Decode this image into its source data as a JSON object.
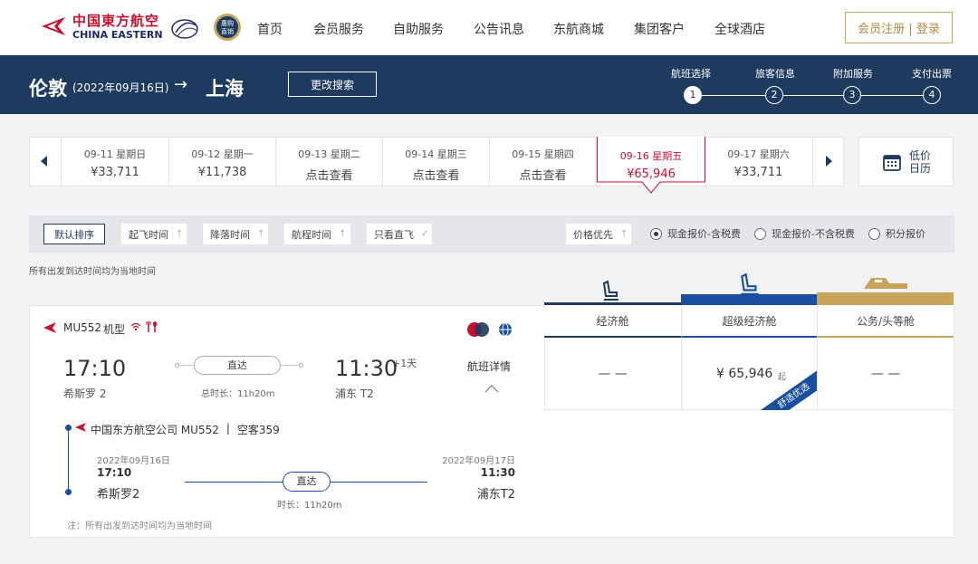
{
  "brand": {
    "name_cn": "中国東方航空",
    "name_en": "CHINA EASTERN",
    "skyteam": "SKYTEAM",
    "badge": "惠购直销"
  },
  "nav": [
    "首页",
    "会员服务",
    "自助服务",
    "公告讯息",
    "东航商城",
    "集团客户",
    "全球酒店"
  ],
  "auth": "会员注册 | 登录",
  "route": {
    "from": "伦敦",
    "date": "(2022年09月16日)",
    "arrow": "→",
    "to": "上海",
    "modify": "更改搜索"
  },
  "steps": [
    {
      "label": "航班选择",
      "num": "1"
    },
    {
      "label": "旅客信息",
      "num": "2"
    },
    {
      "label": "附加服务",
      "num": "3"
    },
    {
      "label": "支付出票",
      "num": "4"
    }
  ],
  "dates": [
    {
      "d": "09-11 星期日",
      "p": "¥33,711"
    },
    {
      "d": "09-12 星期一",
      "p": "¥11,738"
    },
    {
      "d": "09-13 星期二",
      "p": "点击查看"
    },
    {
      "d": "09-14 星期三",
      "p": "点击查看"
    },
    {
      "d": "09-15 星期四",
      "p": "点击查看"
    },
    {
      "d": "09-16 星期五",
      "p": "¥65,946"
    },
    {
      "d": "09-17 星期六",
      "p": "¥33,711"
    }
  ],
  "calendar": {
    "line1": "低价",
    "line2": "日历"
  },
  "sort": {
    "default": "默认排序",
    "dep": "起飞时间",
    "arr": "降落时间",
    "dur": "航程时间",
    "direct": "只看直飞",
    "price": "价格优先"
  },
  "radios": [
    "现金报价-含税费",
    "现金报价-不含税费",
    "积分报价"
  ],
  "note_top": "所有出发到达时间均为当地时间",
  "cabins": [
    "经济舱",
    "超级经济舱",
    "公务/头等舱"
  ],
  "flight": {
    "no": "MU552",
    "type": "机型",
    "dep_time": "17:10",
    "dep_ap": "希斯罗 2",
    "direct": "直达",
    "duration": "总时长：11h20m",
    "arr_time": "11:30",
    "plus": "+1天",
    "arr_ap": "浦东 T2",
    "detail": "航班详情",
    "eco": "— —",
    "super_price": "¥ 65,946",
    "super_suffix": "起",
    "super_tag": "舒适优选",
    "biz": "— —"
  },
  "seg": {
    "carrier": "中国东方航空公司 MU552",
    "sep": "|",
    "plane": "空客359",
    "dep_date": "2022年09月16日",
    "dep_time": "17:10",
    "dep_ap": "希斯罗2",
    "direct": "直达",
    "dur": "时长：11h20m",
    "arr_date": "2022年09月17日",
    "arr_time": "11:30",
    "arr_ap": "浦东T2"
  },
  "note_bottom": "注：所有出发到达时间均为当地时间",
  "colors": {
    "navy": "#1e3a5f",
    "red": "#c8102e",
    "gold": "#c8a45a",
    "super": "#1a4fa0"
  }
}
